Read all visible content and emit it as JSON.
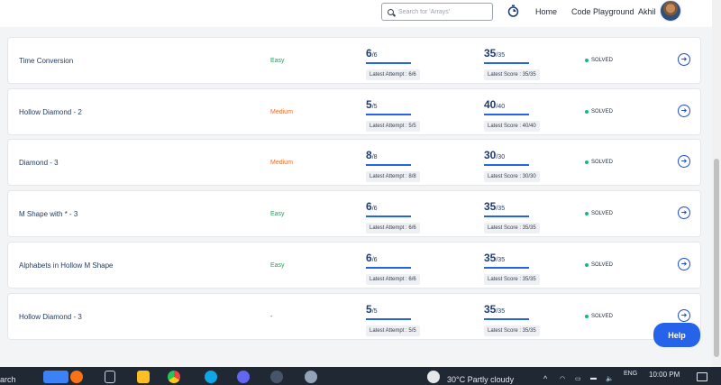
{
  "header": {
    "search_placeholder": "Search for 'Arrays'",
    "nav": {
      "home": "Home",
      "playground": "Code Playground",
      "user": "Akhil"
    }
  },
  "problems": [
    {
      "name": "Time Conversion",
      "difficulty": "Easy",
      "attempt_big": "6",
      "attempt_small": "/6",
      "attempt_label": "Latest Attempt : 6/6",
      "score_big": "35",
      "score_small": "/35",
      "score_label": "Latest Score : 35/35",
      "status": "SOLVED"
    },
    {
      "name": "Hollow Diamond - 2",
      "difficulty": "Medium",
      "attempt_big": "5",
      "attempt_small": "/5",
      "attempt_label": "Latest Attempt : 5/5",
      "score_big": "40",
      "score_small": "/40",
      "score_label": "Latest Score : 40/40",
      "status": "SOLVED"
    },
    {
      "name": "Diamond - 3",
      "difficulty": "Medium",
      "attempt_big": "8",
      "attempt_small": "/8",
      "attempt_label": "Latest Attempt : 8/8",
      "score_big": "30",
      "score_small": "/30",
      "score_label": "Latest Score : 30/30",
      "status": "SOLVED"
    },
    {
      "name": "M Shape with * - 3",
      "difficulty": "Easy",
      "attempt_big": "6",
      "attempt_small": "/6",
      "attempt_label": "Latest Attempt : 6/6",
      "score_big": "35",
      "score_small": "/35",
      "score_label": "Latest Score : 35/35",
      "status": "SOLVED"
    },
    {
      "name": "Alphabets in Hollow M Shape",
      "difficulty": "Easy",
      "attempt_big": "6",
      "attempt_small": "/6",
      "attempt_label": "Latest Attempt : 6/6",
      "score_big": "35",
      "score_small": "/35",
      "score_label": "Latest Score : 35/35",
      "status": "SOLVED"
    },
    {
      "name": "Hollow Diamond - 3",
      "difficulty": "-",
      "attempt_big": "5",
      "attempt_small": "/5",
      "attempt_label": "Latest Attempt : 5/5",
      "score_big": "35",
      "score_small": "/35",
      "score_label": "Latest Score : 35/35",
      "status": "SOLVED"
    }
  ],
  "help": "Help",
  "taskbar": {
    "search": "arch",
    "weather": "30°C  Partly cloudy",
    "lang": "ENG",
    "time": "10:00 PM"
  },
  "colors": {
    "easy": "#22a35a",
    "medium": "#f26a1b",
    "accent": "#2563eb"
  },
  "icons": {
    "search": "search-icon",
    "timer": "timer-icon",
    "arrow": "arrow-right-circle-icon"
  }
}
